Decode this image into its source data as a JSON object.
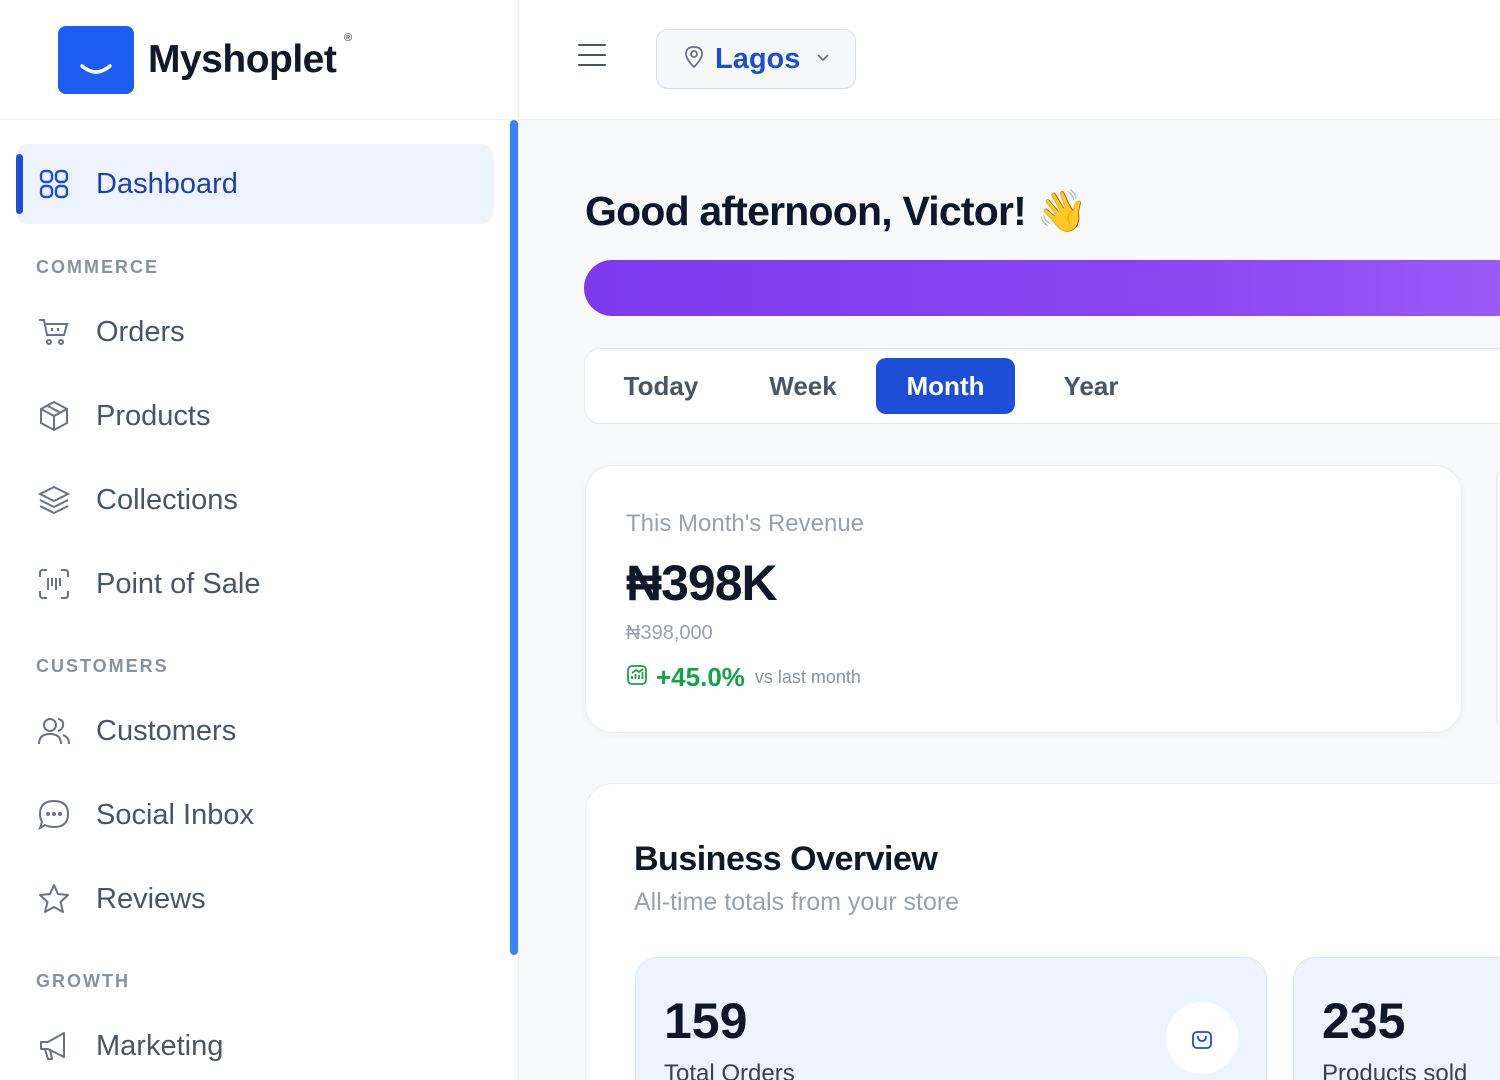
{
  "brand": {
    "name": "Myshoplet",
    "registered_mark": "®",
    "color": "#1d5ef0"
  },
  "header": {
    "location": {
      "label": "Lagos",
      "icon": "map-pin-icon"
    },
    "menu_icon": "hamburger-menu-icon"
  },
  "sidebar": {
    "active_item": {
      "label": "Dashboard",
      "icon": "grid-icon"
    },
    "sections": [
      {
        "title": "COMMERCE",
        "items": [
          {
            "label": "Orders",
            "icon": "shopping-cart-icon"
          },
          {
            "label": "Products",
            "icon": "box-icon"
          },
          {
            "label": "Collections",
            "icon": "layers-icon"
          },
          {
            "label": "Point of Sale",
            "icon": "scan-icon"
          }
        ]
      },
      {
        "title": "CUSTOMERS",
        "items": [
          {
            "label": "Customers",
            "icon": "users-icon"
          },
          {
            "label": "Social Inbox",
            "icon": "chat-bubble-icon"
          },
          {
            "label": "Reviews",
            "icon": "star-icon"
          }
        ]
      },
      {
        "title": "GROWTH",
        "items": [
          {
            "label": "Marketing",
            "icon": "megaphone-icon"
          }
        ]
      }
    ]
  },
  "main": {
    "greeting": "Good afternoon, Victor! 👋",
    "tabs": [
      {
        "label": "Today",
        "active": false
      },
      {
        "label": "Week",
        "active": false
      },
      {
        "label": "Month",
        "active": true
      },
      {
        "label": "Year",
        "active": false
      }
    ],
    "revenue_card": {
      "title": "This Month's Revenue",
      "value": "₦398K",
      "exact": "₦398,000",
      "growth": "+45.0%",
      "growth_note": "vs last month",
      "growth_color": "#16a34a"
    },
    "overview": {
      "title": "Business Overview",
      "subtitle": "All-time totals from your store",
      "stats": [
        {
          "value": "159",
          "label": "Total Orders",
          "icon": "shopping-bag-icon"
        },
        {
          "value": "235",
          "label": "Products sold"
        }
      ]
    }
  },
  "colors": {
    "accent": "#1d4ed8",
    "banner": "#8b45f2",
    "active_bg": "#eef4ff"
  }
}
